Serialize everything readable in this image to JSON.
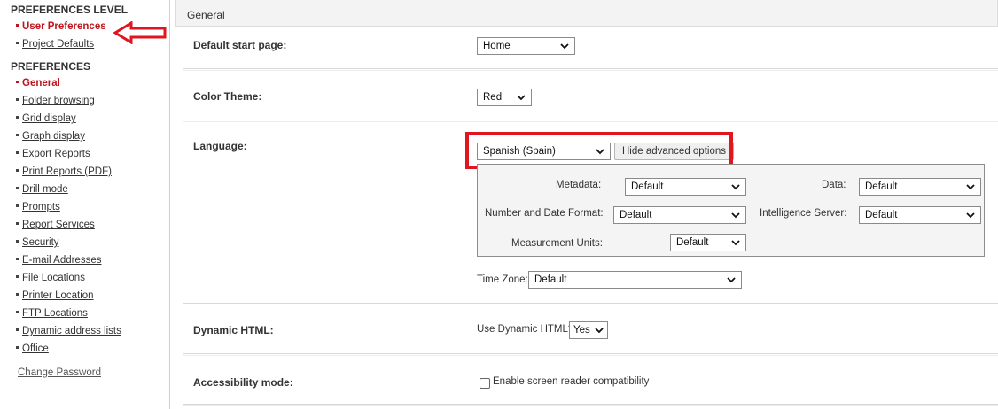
{
  "sidebar": {
    "level_heading": "PREFERENCES LEVEL",
    "level_items": [
      {
        "label": "User Preferences",
        "active": true
      },
      {
        "label": "Project Defaults",
        "active": false
      }
    ],
    "prefs_heading": "PREFERENCES",
    "pref_items": [
      {
        "label": "General",
        "active": true
      },
      {
        "label": "Folder browsing"
      },
      {
        "label": "Grid display"
      },
      {
        "label": "Graph display"
      },
      {
        "label": "Export Reports"
      },
      {
        "label": "Print Reports (PDF)"
      },
      {
        "label": "Drill mode"
      },
      {
        "label": "Prompts"
      },
      {
        "label": "Report Services"
      },
      {
        "label": "Security"
      },
      {
        "label": "E-mail Addresses"
      },
      {
        "label": "File Locations"
      },
      {
        "label": "Printer Location"
      },
      {
        "label": "FTP Locations"
      },
      {
        "label": "Dynamic address lists"
      },
      {
        "label": "Office"
      }
    ],
    "change_password": "Change Password"
  },
  "main": {
    "section_title": "General",
    "default_start_page": {
      "label": "Default start page:",
      "value": "Home"
    },
    "color_theme": {
      "label": "Color Theme:",
      "value": "Red"
    },
    "language": {
      "label": "Language:",
      "value": "Spanish (Spain)",
      "hide_advanced_button": "Hide advanced options",
      "advanced": {
        "metadata_label": "Metadata:",
        "metadata_value": "Default",
        "data_label": "Data:",
        "data_value": "Default",
        "number_date_label": "Number and Date Format:",
        "number_date_value": "Default",
        "intelligence_label": "Intelligence Server:",
        "intelligence_value": "Default",
        "measurement_label": "Measurement Units:",
        "measurement_value": "Default"
      },
      "time_zone_label": "Time Zone:",
      "time_zone_value": "Default"
    },
    "dynamic_html": {
      "label": "Dynamic HTML:",
      "question": "Use Dynamic HTML?",
      "value": "Yes"
    },
    "accessibility": {
      "label": "Accessibility mode:",
      "checkbox_label": "Enable screen reader compatibility",
      "checked": false
    }
  },
  "colors": {
    "accent_red": "#c0141c",
    "highlight_red": "#e0151f"
  }
}
